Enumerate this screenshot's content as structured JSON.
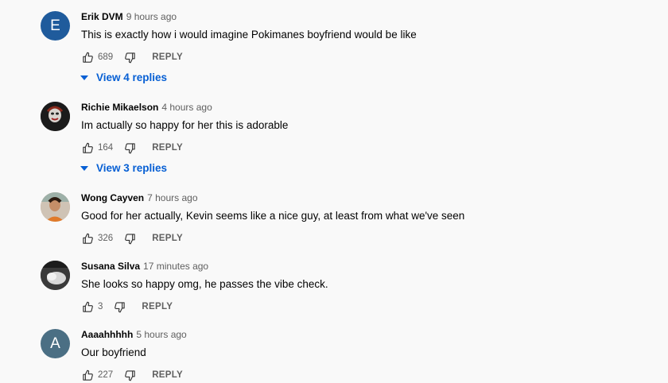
{
  "colors": {
    "avatar_e": "#1f5b9c",
    "avatar_a": "#4b6f84",
    "link_blue": "#065fd4"
  },
  "comments": [
    {
      "author": "Erik DVM",
      "time": "9 hours ago",
      "text": "This is exactly how i would imagine Pokimanes boyfriend would be like",
      "likes": "689",
      "reply_label": "REPLY",
      "avatar_letter": "E",
      "view_replies": "View 4 replies"
    },
    {
      "author": "Richie Mikaelson",
      "time": "4 hours ago",
      "text": "Im actually so happy for her this is adorable",
      "likes": "164",
      "reply_label": "REPLY",
      "view_replies": "View 3 replies"
    },
    {
      "author": "Wong Cayven",
      "time": "7 hours ago",
      "text": "Good for her actually, Kevin seems like a nice guy, at least from what we've seen",
      "likes": "326",
      "reply_label": "REPLY"
    },
    {
      "author": "Susana Silva",
      "time": "17 minutes ago",
      "text": "She looks so happy omg, he passes the vibe check.",
      "likes": "3",
      "reply_label": "REPLY"
    },
    {
      "author": "Aaaahhhhh",
      "time": "5 hours ago",
      "text": "Our boyfriend",
      "likes": "227",
      "reply_label": "REPLY",
      "avatar_letter": "A"
    }
  ]
}
